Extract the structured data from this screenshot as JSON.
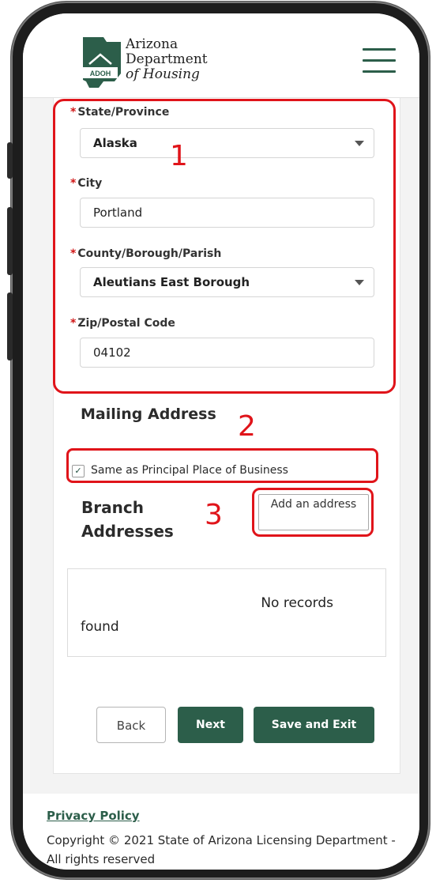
{
  "header": {
    "logo_badge": "ADOH",
    "org_line1": "Arizona",
    "org_line2": "Department",
    "org_line3": "of Housing"
  },
  "form": {
    "state": {
      "label": "State/Province",
      "value": "Alaska"
    },
    "city": {
      "label": "City",
      "value": "Portland"
    },
    "county": {
      "label": "County/Borough/Parish",
      "value": "Aleutians East Borough"
    },
    "zip": {
      "label": "Zip/Postal Code",
      "value": "04102"
    },
    "required_marker": "*"
  },
  "mailing": {
    "title": "Mailing Address",
    "checkbox_label": "Same as Principal Place of Business",
    "checkbox_checked": true,
    "check_glyph": "✓"
  },
  "branch": {
    "title": "Branch Addresses",
    "add_button": "Add an address",
    "empty_line1": "No records",
    "empty_line2": "found"
  },
  "actions": {
    "back": "Back",
    "next": "Next",
    "save_exit": "Save and Exit"
  },
  "footer": {
    "privacy": "Privacy Policy",
    "copyright": "Copyright © 2021 State of Arizona Licensing Department - All rights reserved"
  },
  "annotations": {
    "n1": "1",
    "n2": "2",
    "n3": "3",
    "color": "#e0141a"
  },
  "colors": {
    "brand_green": "#2c5e4a",
    "required_red": "#d01515"
  }
}
